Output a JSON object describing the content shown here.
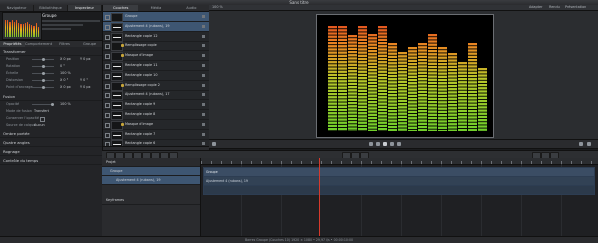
{
  "window": {
    "title": "Sans titre"
  },
  "left_tabs": [
    "Navigateur",
    "Bibliothèque",
    "Inspecteur"
  ],
  "left_tab_active": 2,
  "preview": {
    "name": "Groupe"
  },
  "inspector_tabs": [
    "Propriétés",
    "Comportement",
    "Filtres",
    "Groupe"
  ],
  "inspector_tab_active": 0,
  "inspector": {
    "sections": [
      "Transformer",
      "Fusion",
      "Ombre portée",
      "Quatre angles",
      "Rognage",
      "Contrôle du temps"
    ],
    "rows": [
      {
        "label": "Position",
        "v1": "X  0 px",
        "v2": "Y  0 px"
      },
      {
        "label": "Rotation",
        "v1": "0 °",
        "v2": ""
      },
      {
        "label": "Échelle",
        "v1": "100 %",
        "v2": ""
      },
      {
        "label": "Distorsion",
        "v1": "X  0 °",
        "v2": "Y  0 °"
      },
      {
        "label": "Point d’ancrage",
        "v1": "X  0 px",
        "v2": "Y  0 px"
      }
    ],
    "fusion_rows": [
      {
        "label": "Opacité",
        "v1": "100 %"
      },
      {
        "label": "Mode de fusion",
        "v1": "Transfert"
      },
      {
        "label": "Conserver l’opacité",
        "v1": ""
      },
      {
        "label": "Source de calque",
        "v1": "Aucun"
      }
    ]
  },
  "middle_tabs": [
    "Couches",
    "Média",
    "Audio"
  ],
  "middle_tab_active": 0,
  "layers": [
    {
      "name": "Groupe",
      "kind": "group",
      "selected": true
    },
    {
      "name": "Ajustement 4 (rubans), 19",
      "kind": "bar",
      "selected": true
    },
    {
      "name": "Rectangle copie 12",
      "kind": "bar",
      "selected": false
    },
    {
      "name": "Remplissage copie",
      "kind": "fill",
      "selected": false
    },
    {
      "name": "Masque d’image",
      "kind": "mask",
      "selected": false
    },
    {
      "name": "Rectangle copie 11",
      "kind": "bar",
      "selected": false
    },
    {
      "name": "Rectangle copie 10",
      "kind": "bar",
      "selected": false
    },
    {
      "name": "Remplissage copie 2",
      "kind": "fill",
      "selected": false
    },
    {
      "name": "Ajustement 4 (rubans), 17",
      "kind": "bar",
      "selected": false
    },
    {
      "name": "Rectangle copie 9",
      "kind": "bar",
      "selected": false
    },
    {
      "name": "Rectangle copie 8",
      "kind": "bar",
      "selected": false
    },
    {
      "name": "Masque d’image",
      "kind": "mask",
      "selected": false
    },
    {
      "name": "Rectangle copie 7",
      "kind": "bar",
      "selected": false
    },
    {
      "name": "Rectangle copie 6",
      "kind": "bar",
      "selected": false
    }
  ],
  "canvas_toolbar": {
    "left": "100 %",
    "right_items": [
      "Adapter",
      "Rendu",
      "Présentation"
    ]
  },
  "equalizer": {
    "levels": [
      0.93,
      0.93,
      0.85,
      0.93,
      0.86,
      0.93,
      0.78,
      0.7,
      0.74,
      0.78,
      0.86,
      0.74,
      0.69,
      0.61,
      0.78,
      0.56
    ],
    "colors": {
      "bottom": "#6fcf2a",
      "mid": "#e88a22",
      "top": "#e3431f"
    }
  },
  "timeline": {
    "rows": [
      {
        "name": "Projet",
        "selected": false
      },
      {
        "name": "Groupe",
        "selected": true
      },
      {
        "name": "Ajustement 4 (rubans), 19",
        "selected": true
      }
    ],
    "clips": [
      {
        "label": "Groupe"
      },
      {
        "label": "Ajustement 4 (rubans), 19"
      }
    ],
    "keyframes_label": "Keyframes"
  },
  "status": {
    "text": "Barres Groupe (Couches 10) 1920 × 1080 • 29,97 i/s • 00:00:10:00"
  }
}
